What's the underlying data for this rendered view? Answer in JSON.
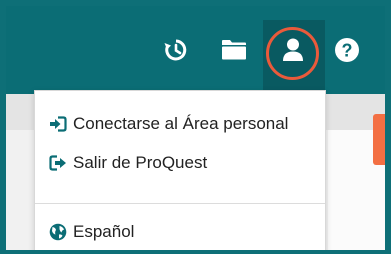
{
  "toolbar": {
    "icons": [
      "history-icon",
      "folder-icon",
      "user-icon",
      "help-icon"
    ],
    "active": "user-icon"
  },
  "user_menu": {
    "items": [
      {
        "label": "Conectarse al Área personal",
        "icon": "sign-in-icon"
      },
      {
        "label": "Salir de ProQuest",
        "icon": "sign-out-icon"
      },
      {
        "label": "Español",
        "icon": "globe-icon"
      }
    ]
  },
  "colors": {
    "header": "#0b6d75",
    "accent": "#ea5a3b",
    "menu_icon": "#0b6d75"
  }
}
